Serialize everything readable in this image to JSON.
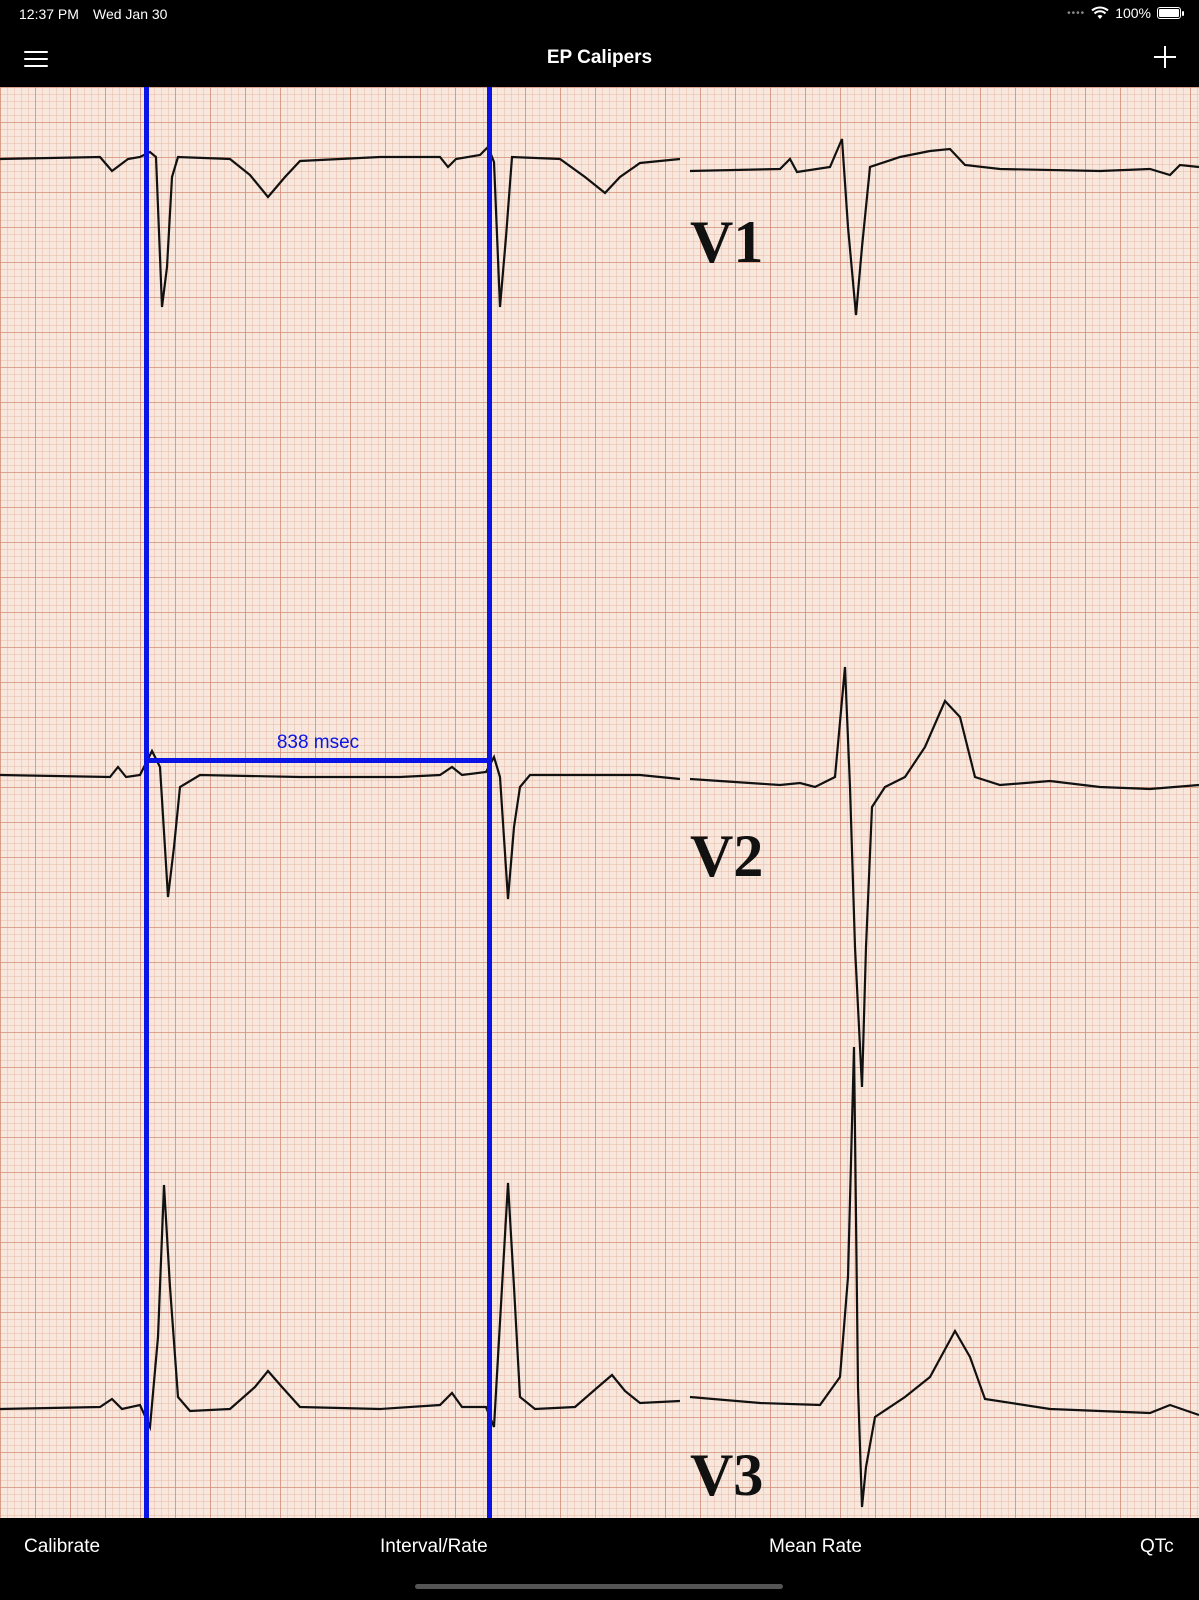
{
  "status": {
    "time": "12:37 PM",
    "date": "Wed Jan 30",
    "battery": "100%",
    "battery_level": 1.0
  },
  "nav": {
    "title": "EP Calipers",
    "menu_icon": "hamburger-menu-icon",
    "add_icon": "plus-icon"
  },
  "ecg": {
    "lead_labels": [
      "V1",
      "V2",
      "V3"
    ],
    "caliper_color": "#0a14e6",
    "trace_color": "#111111",
    "grid_minor_color": "#e8b8a4",
    "grid_major_color": "#d08a70",
    "caliper": {
      "label": "838 msec"
    }
  },
  "toolbar": {
    "items": [
      "Calibrate",
      "Interval/Rate",
      "Mean Rate",
      "QTc"
    ]
  }
}
